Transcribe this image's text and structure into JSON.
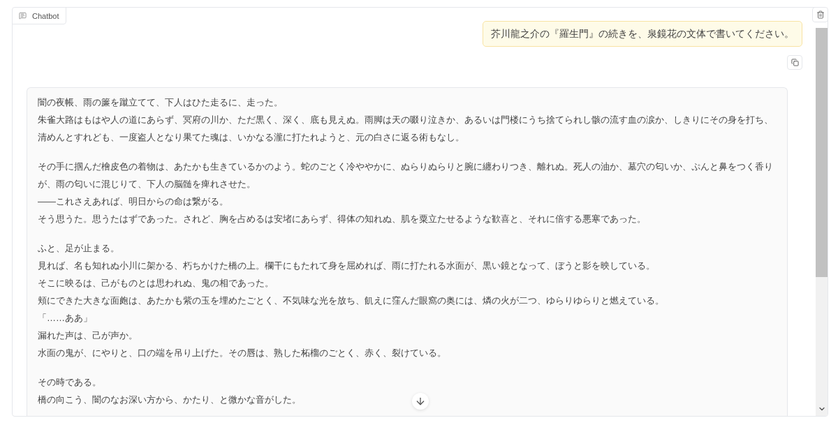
{
  "panel": {
    "label": "Chatbot"
  },
  "messages": [
    {
      "kind": "user",
      "copyable": true,
      "paragraphs": [
        [
          "芥川龍之介の『羅生門』の続きを、泉鏡花の文体で書いてください。"
        ]
      ]
    },
    {
      "kind": "bot",
      "paragraphs": [
        [
          "闇の夜帳、雨の簾を蹴立てて、下人はひた走るに、走った。",
          "朱雀大路はもはや人の道にあらず、冥府の川か、ただ黒く、深く、底も見えぬ。雨脚は天の啜り泣きか、あるいは門楼にうち捨てられし骸の流す血の涙か、しきりにその身を打ち、清めんとすれども、一度盗人となり果てた魂は、いかなる瀧に打たれようと、元の白さに返る術もなし。"
        ],
        [
          "その手に掴んだ檜皮色の着物は、あたかも生きているかのよう。蛇のごとく冷ややかに、ぬらりぬらりと腕に纏わりつき、離れぬ。死人の油か、墓穴の匂いか、ぷんと鼻をつく香りが、雨の匂いに混じりて、下人の脳髄を痺れさせた。",
          "——これさえあれば、明日からの命は繋がる。",
          "そう思うた。思うたはずであった。されど、胸を占めるは安堵にあらず、得体の知れぬ、肌を粟立たせるような歓喜と、それに倍する悪寒であった。"
        ],
        [
          "ふと、足が止まる。",
          "見れば、名も知れぬ小川に架かる、朽ちかけた橋の上。欄干にもたれて身を屈めれば、雨に打たれる水面が、黒い鏡となって、ぼうと影を映している。",
          "そこに映るは、己がものとは思われぬ、鬼の相であった。",
          "頬にできた大きな面皰は、あたかも紫の玉を埋めたごとく、不気味な光を放ち、飢えに窪んだ眼窩の奥には、燐の火が二つ、ゆらりゆらりと燃えている。",
          "「……ああ」",
          "漏れた声は、己が声か。",
          "水面の鬼が、にやりと、口の端を吊り上げた。その唇は、熟した柘榴のごとく、赤く、裂けている。"
        ],
        [
          "その時である。",
          "橋の向こう、闇のなお深い方から、かたり、と微かな音がした。"
        ]
      ]
    }
  ]
}
